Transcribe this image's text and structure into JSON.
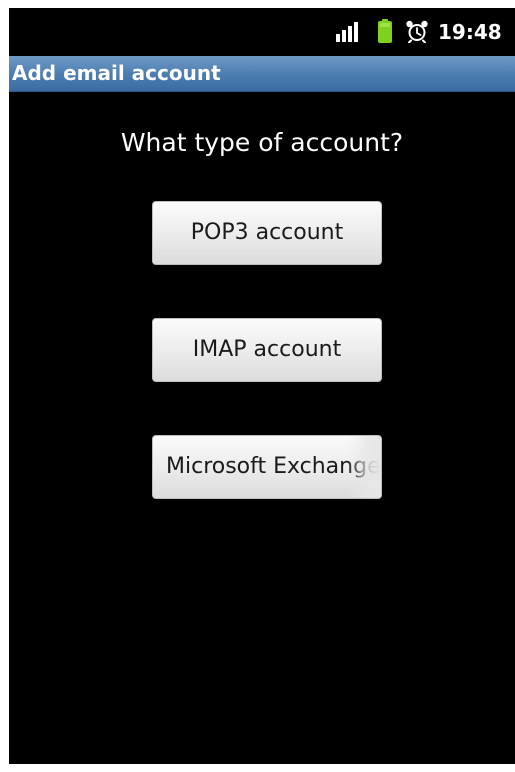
{
  "status_bar": {
    "time": "19:48",
    "signal_icon": "signal-bars-icon",
    "battery_icon": "battery-icon",
    "alarm_icon": "alarm-clock-icon",
    "battery_color": "#7fd120"
  },
  "header": {
    "title": "Add email account"
  },
  "main": {
    "prompt": "What type of account?",
    "buttons": [
      {
        "label": "POP3 account"
      },
      {
        "label": "IMAP account"
      },
      {
        "label": "Microsoft Exchange"
      }
    ]
  },
  "colors": {
    "title_bar": "#4a7cb0",
    "background": "#000000",
    "button_bg": "#eeeeee",
    "button_text": "#1b1b1b"
  }
}
